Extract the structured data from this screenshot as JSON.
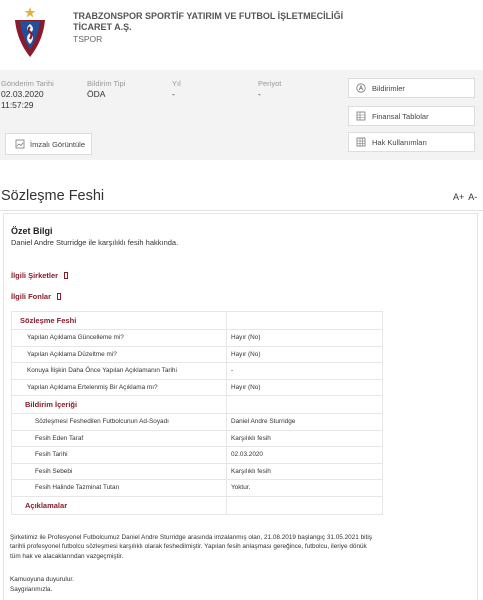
{
  "header": {
    "company_name": "TRABZONSPOR SPORTİF YATIRIM VE FUTBOL İŞLETMECİLİĞİ TİCARET A.Ş.",
    "company_code": "TSPOR",
    "logo_icon": "trabzonspor-crest-icon"
  },
  "info": {
    "date_label": "Gönderim Tarihi",
    "date_value": "02.03.2020",
    "time_value": "11:57:29",
    "type_label": "Bildirim Tipi",
    "type_value": "ÖDA",
    "year_label": "Yıl",
    "year_value": "-",
    "period_label": "Periyot",
    "period_value": "-",
    "signed_button": "İmzalı Görüntüle",
    "notifications_button": "Bildirimler",
    "financials_button": "Finansal Tablolar",
    "rights_button": "Hak Kullanımları"
  },
  "title": {
    "text": "Sözleşme Feshi",
    "increase": "A+",
    "decrease": "A-"
  },
  "summary": {
    "heading": "Özet Bilgi",
    "text": "Daniel Andre Sturridge ile karşılıklı fesih hakkında."
  },
  "links": {
    "related_companies": "İlgili Şirketler",
    "related_funds": "İlgili Fonlar"
  },
  "table": {
    "section_title": "Sözleşme Feshi",
    "q1": "Yapılan Açıklama Güncelleme mi?",
    "a1": "Hayır (No)",
    "q2": "Yapılan Açıklama Düzeltme mi?",
    "a2": "Hayır (No)",
    "q3": "Konuya İlişkin Daha Önce Yapılan Açıklamanın Tarihi",
    "a3": "-",
    "q4": "Yapılan Açıklama Ertelenmiş Bir Açıklama mı?",
    "a4": "Hayır (No)",
    "content_title": "Bildirim İçeriği",
    "f1": "Sözleşmesi Feshedilen Futbolcunun Ad-Soyadı",
    "v1": "Daniel Andre Sturridge",
    "f2": "Fesih Eden Taraf",
    "v2": "Karşılıklı fesih",
    "f3": "Fesih Tarihi",
    "v3": "02.03.2020",
    "f4": "Fesih Sebebi",
    "v4": "Karşılıklı fesih",
    "f5": "Fesih Halinde Tazminat Tutarı",
    "v5": "Yoktur.",
    "explanations_title": "Açıklamalar"
  },
  "explanation": {
    "text": "Şirketimiz ile Profesyonel Futbolcumuz Daniel Andre Sturridge arasında imzalanmış olan, 21.08.2019 başlangıç 31.05.2021 bitiş tarihli profesyonel futbolcu sözleşmesi karşılıklı olarak feshedilmiştir. Yapılan fesih anlaşması gereğince, futbolcu, ileriye dönük tüm hak ve alacaklarından vazgeçmiştir.",
    "line1": "Kamuoyuna duyurulur.",
    "line2": "Saygılarımızla."
  },
  "colors": {
    "maroon": "#8a1b2a",
    "blue": "#1f4f9f",
    "band": "#f3f3f3"
  }
}
